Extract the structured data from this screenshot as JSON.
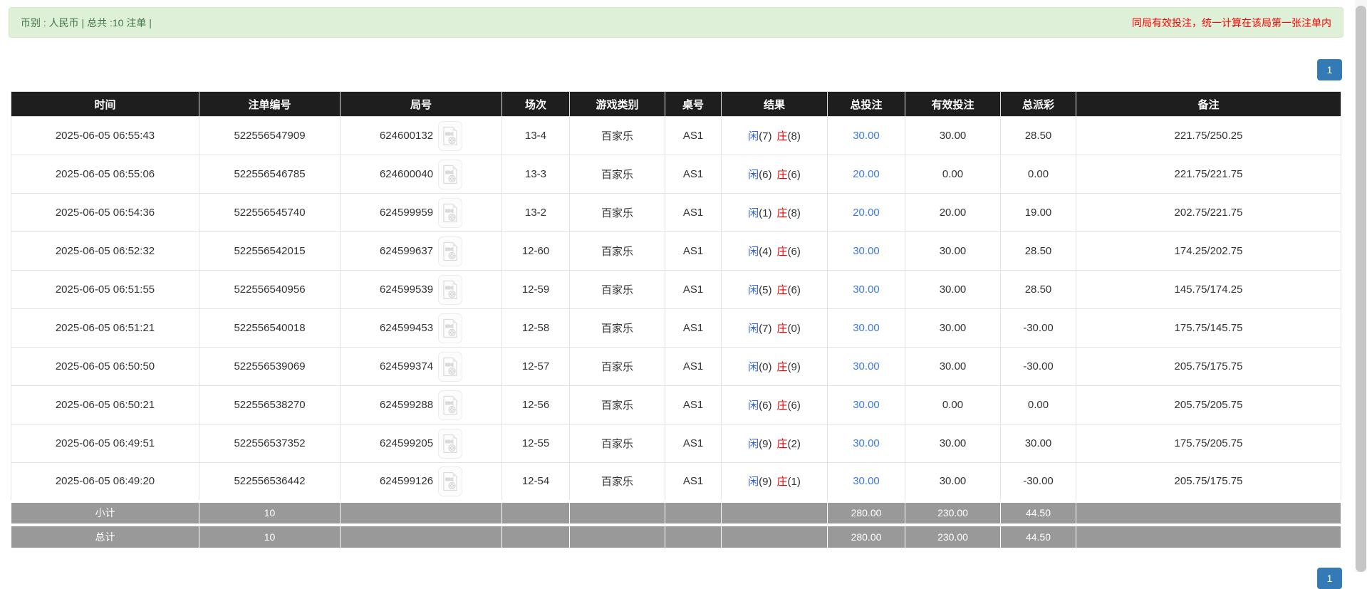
{
  "banner": {
    "left": "币别 : 人民币 | 总共 :10 注单 |",
    "right": "同局有效投注，统一计算在该局第一张注单内"
  },
  "pagination": {
    "page": "1"
  },
  "icons": {
    "video_icon": "video-replay-icon"
  },
  "colors": {
    "banner_bg": "#dff0d8",
    "banner_border": "#d6e9c6",
    "banner_text": "#3c763d",
    "note_red": "#ff0000",
    "header_bg": "#1e1e1e",
    "footer_bg": "#999999",
    "player_blue": "#2e5fe8",
    "banker_red": "#e60000",
    "amount_link_blue": "#3b78e7",
    "negative_red": "#ff0000",
    "pagination_blue": "#337ab7"
  },
  "table": {
    "columns": [
      "时间",
      "注单编号",
      "局号",
      "场次",
      "游戏类别",
      "桌号",
      "结果",
      "总投注",
      "有效投注",
      "总派彩",
      "备注"
    ],
    "rows": [
      {
        "time": "2025-06-05 06:55:43",
        "bet_id": "522556547909",
        "round": "624600132",
        "session": "13-4",
        "game": "百家乐",
        "table_no": "AS1",
        "player_label": "闲",
        "player_num": "(7)",
        "banker_label": "庄",
        "banker_num": "(8)",
        "total_bet": "30.00",
        "valid_bet": "30.00",
        "payout": "28.50",
        "note": "221.75/250.25"
      },
      {
        "time": "2025-06-05 06:55:06",
        "bet_id": "522556546785",
        "round": "624600040",
        "session": "13-3",
        "game": "百家乐",
        "table_no": "AS1",
        "player_label": "闲",
        "player_num": "(6)",
        "banker_label": "庄",
        "banker_num": "(6)",
        "total_bet": "20.00",
        "valid_bet": "0.00",
        "payout": "0.00",
        "note": "221.75/221.75"
      },
      {
        "time": "2025-06-05 06:54:36",
        "bet_id": "522556545740",
        "round": "624599959",
        "session": "13-2",
        "game": "百家乐",
        "table_no": "AS1",
        "player_label": "闲",
        "player_num": "(1)",
        "banker_label": "庄",
        "banker_num": "(8)",
        "total_bet": "20.00",
        "valid_bet": "20.00",
        "payout": "19.00",
        "note": "202.75/221.75"
      },
      {
        "time": "2025-06-05 06:52:32",
        "bet_id": "522556542015",
        "round": "624599637",
        "session": "12-60",
        "game": "百家乐",
        "table_no": "AS1",
        "player_label": "闲",
        "player_num": "(4)",
        "banker_label": "庄",
        "banker_num": "(6)",
        "total_bet": "30.00",
        "valid_bet": "30.00",
        "payout": "28.50",
        "note": "174.25/202.75"
      },
      {
        "time": "2025-06-05 06:51:55",
        "bet_id": "522556540956",
        "round": "624599539",
        "session": "12-59",
        "game": "百家乐",
        "table_no": "AS1",
        "player_label": "闲",
        "player_num": "(5)",
        "banker_label": "庄",
        "banker_num": "(6)",
        "total_bet": "30.00",
        "valid_bet": "30.00",
        "payout": "28.50",
        "note": "145.75/174.25"
      },
      {
        "time": "2025-06-05 06:51:21",
        "bet_id": "522556540018",
        "round": "624599453",
        "session": "12-58",
        "game": "百家乐",
        "table_no": "AS1",
        "player_label": "闲",
        "player_num": "(7)",
        "banker_label": "庄",
        "banker_num": "(0)",
        "total_bet": "30.00",
        "valid_bet": "30.00",
        "payout": "-30.00",
        "note": "175.75/145.75"
      },
      {
        "time": "2025-06-05 06:50:50",
        "bet_id": "522556539069",
        "round": "624599374",
        "session": "12-57",
        "game": "百家乐",
        "table_no": "AS1",
        "player_label": "闲",
        "player_num": "(0)",
        "banker_label": "庄",
        "banker_num": "(9)",
        "total_bet": "30.00",
        "valid_bet": "30.00",
        "payout": "-30.00",
        "note": "205.75/175.75"
      },
      {
        "time": "2025-06-05 06:50:21",
        "bet_id": "522556538270",
        "round": "624599288",
        "session": "12-56",
        "game": "百家乐",
        "table_no": "AS1",
        "player_label": "闲",
        "player_num": "(6)",
        "banker_label": "庄",
        "banker_num": "(6)",
        "total_bet": "30.00",
        "valid_bet": "0.00",
        "payout": "0.00",
        "note": "205.75/205.75"
      },
      {
        "time": "2025-06-05 06:49:51",
        "bet_id": "522556537352",
        "round": "624599205",
        "session": "12-55",
        "game": "百家乐",
        "table_no": "AS1",
        "player_label": "闲",
        "player_num": "(9)",
        "banker_label": "庄",
        "banker_num": "(2)",
        "total_bet": "30.00",
        "valid_bet": "30.00",
        "payout": "30.00",
        "note": "175.75/205.75"
      },
      {
        "time": "2025-06-05 06:49:20",
        "bet_id": "522556536442",
        "round": "624599126",
        "session": "12-54",
        "game": "百家乐",
        "table_no": "AS1",
        "player_label": "闲",
        "player_num": "(9)",
        "banker_label": "庄",
        "banker_num": "(1)",
        "total_bet": "30.00",
        "valid_bet": "30.00",
        "payout": "-30.00",
        "note": "205.75/175.75"
      }
    ],
    "subtotal": {
      "label": "小计",
      "count": "10",
      "total_bet": "280.00",
      "valid_bet": "230.00",
      "payout": "44.50"
    },
    "total": {
      "label": "总计",
      "count": "10",
      "total_bet": "280.00",
      "valid_bet": "230.00",
      "payout": "44.50"
    }
  }
}
